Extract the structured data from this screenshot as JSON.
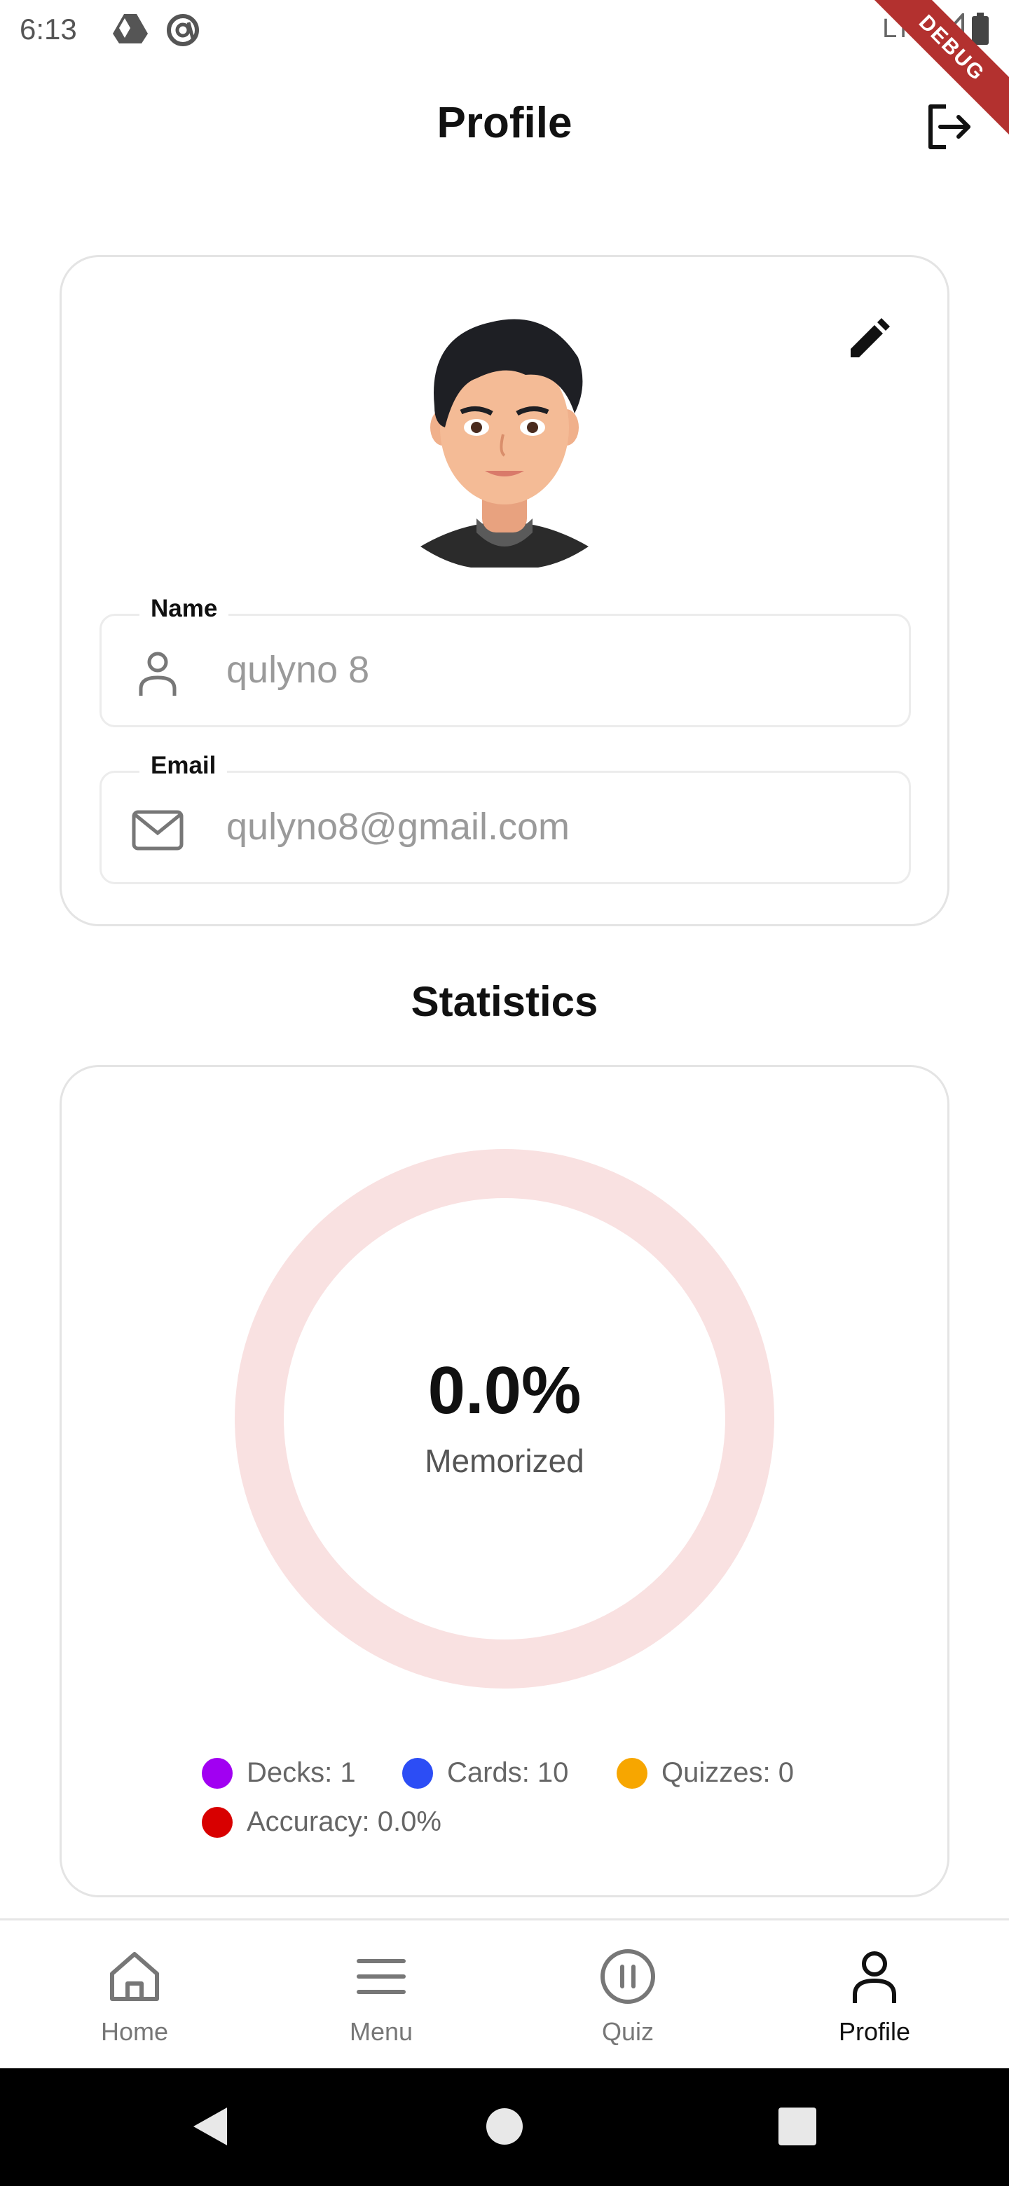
{
  "status_bar": {
    "time": "6:13",
    "network": "LTE",
    "debug_label": "DEBUG"
  },
  "app_bar": {
    "title": "Profile",
    "logout_icon": "logout-icon"
  },
  "profile": {
    "edit_icon": "pencil-icon",
    "name_label": "Name",
    "name_value": "qulyno 8",
    "email_label": "Email",
    "email_value": "qulyno8@gmail.com"
  },
  "statistics": {
    "title": "Statistics",
    "percent_text": "0.0%",
    "caption": "Memorized",
    "legend": [
      {
        "label": "Decks: 1",
        "color": "#a100f2"
      },
      {
        "label": "Cards: 10",
        "color": "#2c4df5"
      },
      {
        "label": "Quizzes: 0",
        "color": "#f7a600"
      },
      {
        "label": "Accuracy: 0.0%",
        "color": "#d80000"
      }
    ],
    "ring_color": "#f9e1e1"
  },
  "bottom_nav": {
    "items": [
      {
        "label": "Home",
        "icon": "home-icon"
      },
      {
        "label": "Menu",
        "icon": "menu-icon"
      },
      {
        "label": "Quiz",
        "icon": "pause-circle-icon"
      },
      {
        "label": "Profile",
        "icon": "person-icon"
      }
    ],
    "active": "Profile"
  }
}
